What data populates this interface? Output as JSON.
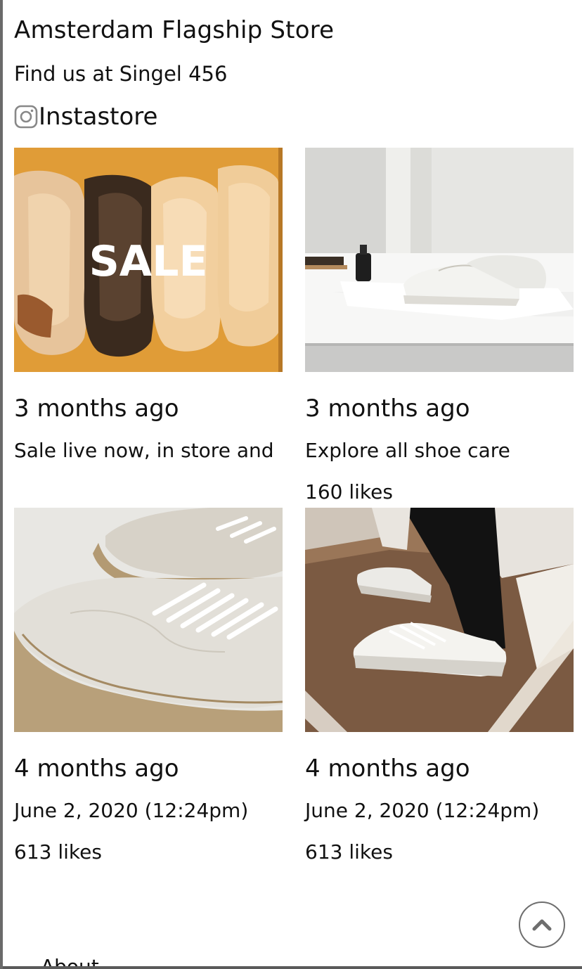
{
  "header": {
    "title": "Amsterdam Flagship Store",
    "address": "Find us at Singel 456",
    "instagram_label": "Instastore",
    "instagram_icon": "instagram-icon"
  },
  "posts": [
    {
      "overlay": "SALE",
      "time": "3 months ago",
      "caption": "Sale live now, in store and",
      "likes": ""
    },
    {
      "time": "3 months ago",
      "caption": "Explore all shoe care",
      "likes": "160 likes"
    },
    {
      "time": "4 months ago",
      "caption": "June 2, 2020 (12:24pm)",
      "likes": "613 likes"
    },
    {
      "time": "4 months ago",
      "caption": "June 2, 2020 (12:24pm)",
      "likes": "613 likes"
    }
  ],
  "footer": {
    "peek_text": "About"
  },
  "controls": {
    "scroll_top_icon": "chevron-up-icon"
  },
  "colors": {
    "sale_bg": "#e3a13d",
    "text": "#111111"
  }
}
